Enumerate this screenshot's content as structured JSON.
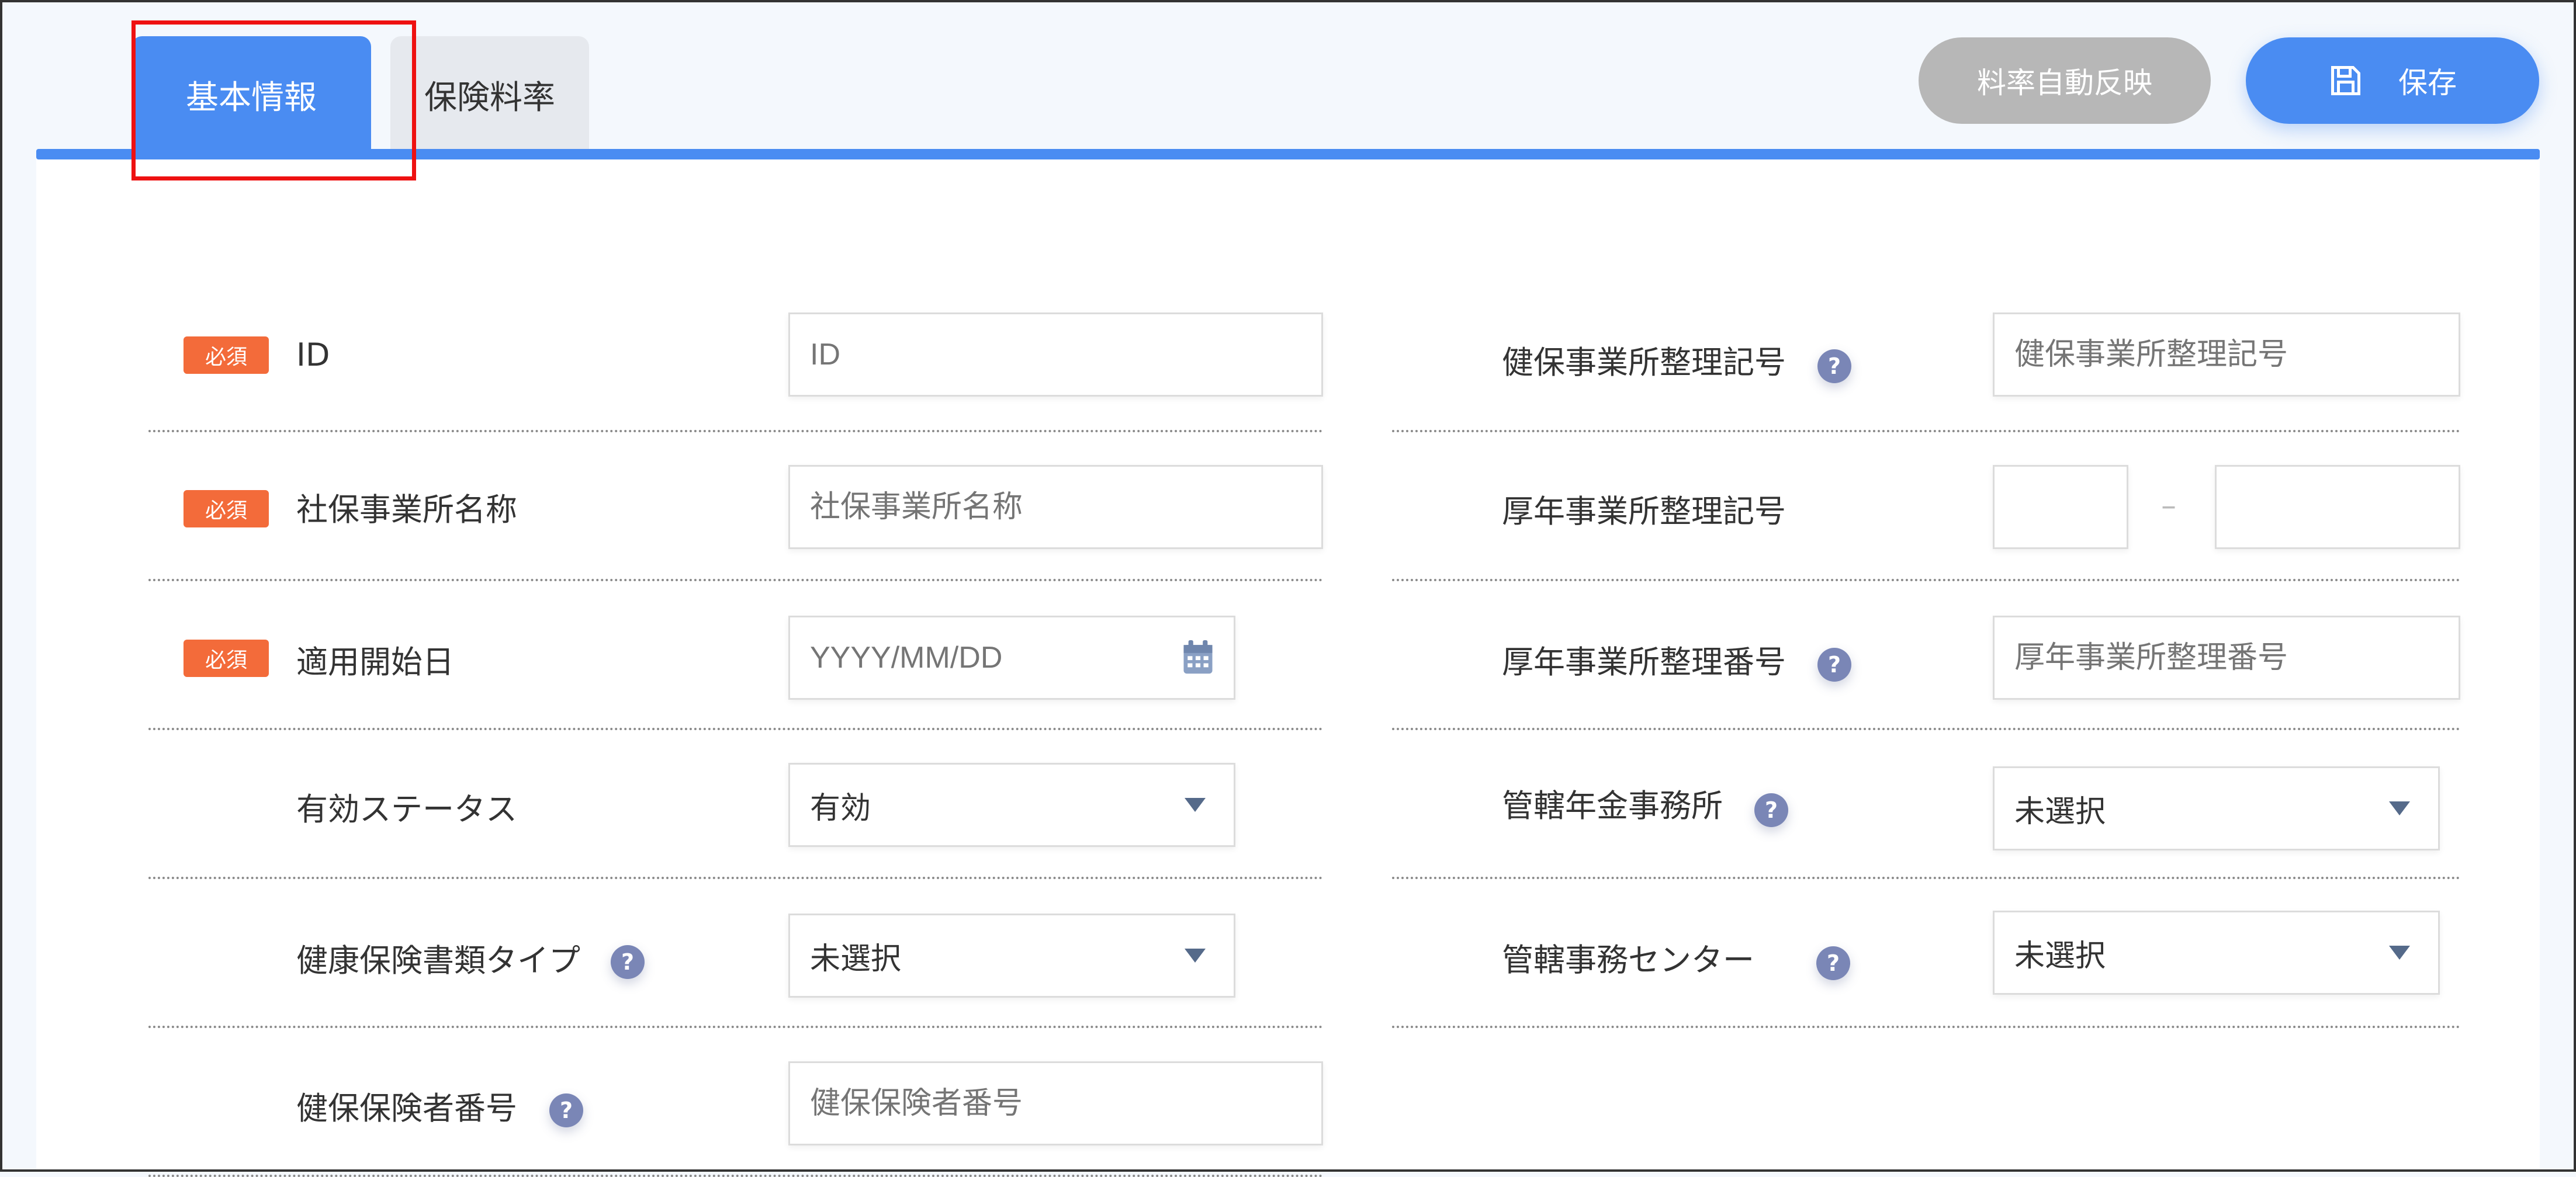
{
  "tabs": [
    {
      "label": "基本情報",
      "active": true
    },
    {
      "label": "保険料率",
      "active": false
    }
  ],
  "actions": {
    "auto_reflect": "料率自動反映",
    "save": "保存"
  },
  "colors": {
    "accent": "#4a8cf2",
    "required": "#f36b3a",
    "help": "#7a86b6",
    "annotation": "#ee1111"
  },
  "required_badge": "必須",
  "help_mark": "?",
  "left_fields": [
    {
      "label": "ID",
      "placeholder": "ID"
    },
    {
      "label": "社保事業所名称",
      "placeholder": "社保事業所名称"
    },
    {
      "label": "適用開始日",
      "placeholder": "YYYY/MM/DD"
    },
    {
      "label": "有効ステータス",
      "value": "有効"
    },
    {
      "label": "健康保険書類タイプ",
      "value": "未選択"
    },
    {
      "label": "健保保険者番号",
      "placeholder": "健保保険者番号"
    }
  ],
  "right_fields": [
    {
      "label": "健保事業所整理記号",
      "placeholder": "健保事業所整理記号"
    },
    {
      "label": "厚年事業所整理記号",
      "separator": "–"
    },
    {
      "label": "厚年事業所整理番号",
      "placeholder": "厚年事業所整理番号"
    },
    {
      "label": "管轄年金事務所",
      "value": "未選択"
    },
    {
      "label": "管轄事務センター",
      "value": "未選択"
    }
  ]
}
